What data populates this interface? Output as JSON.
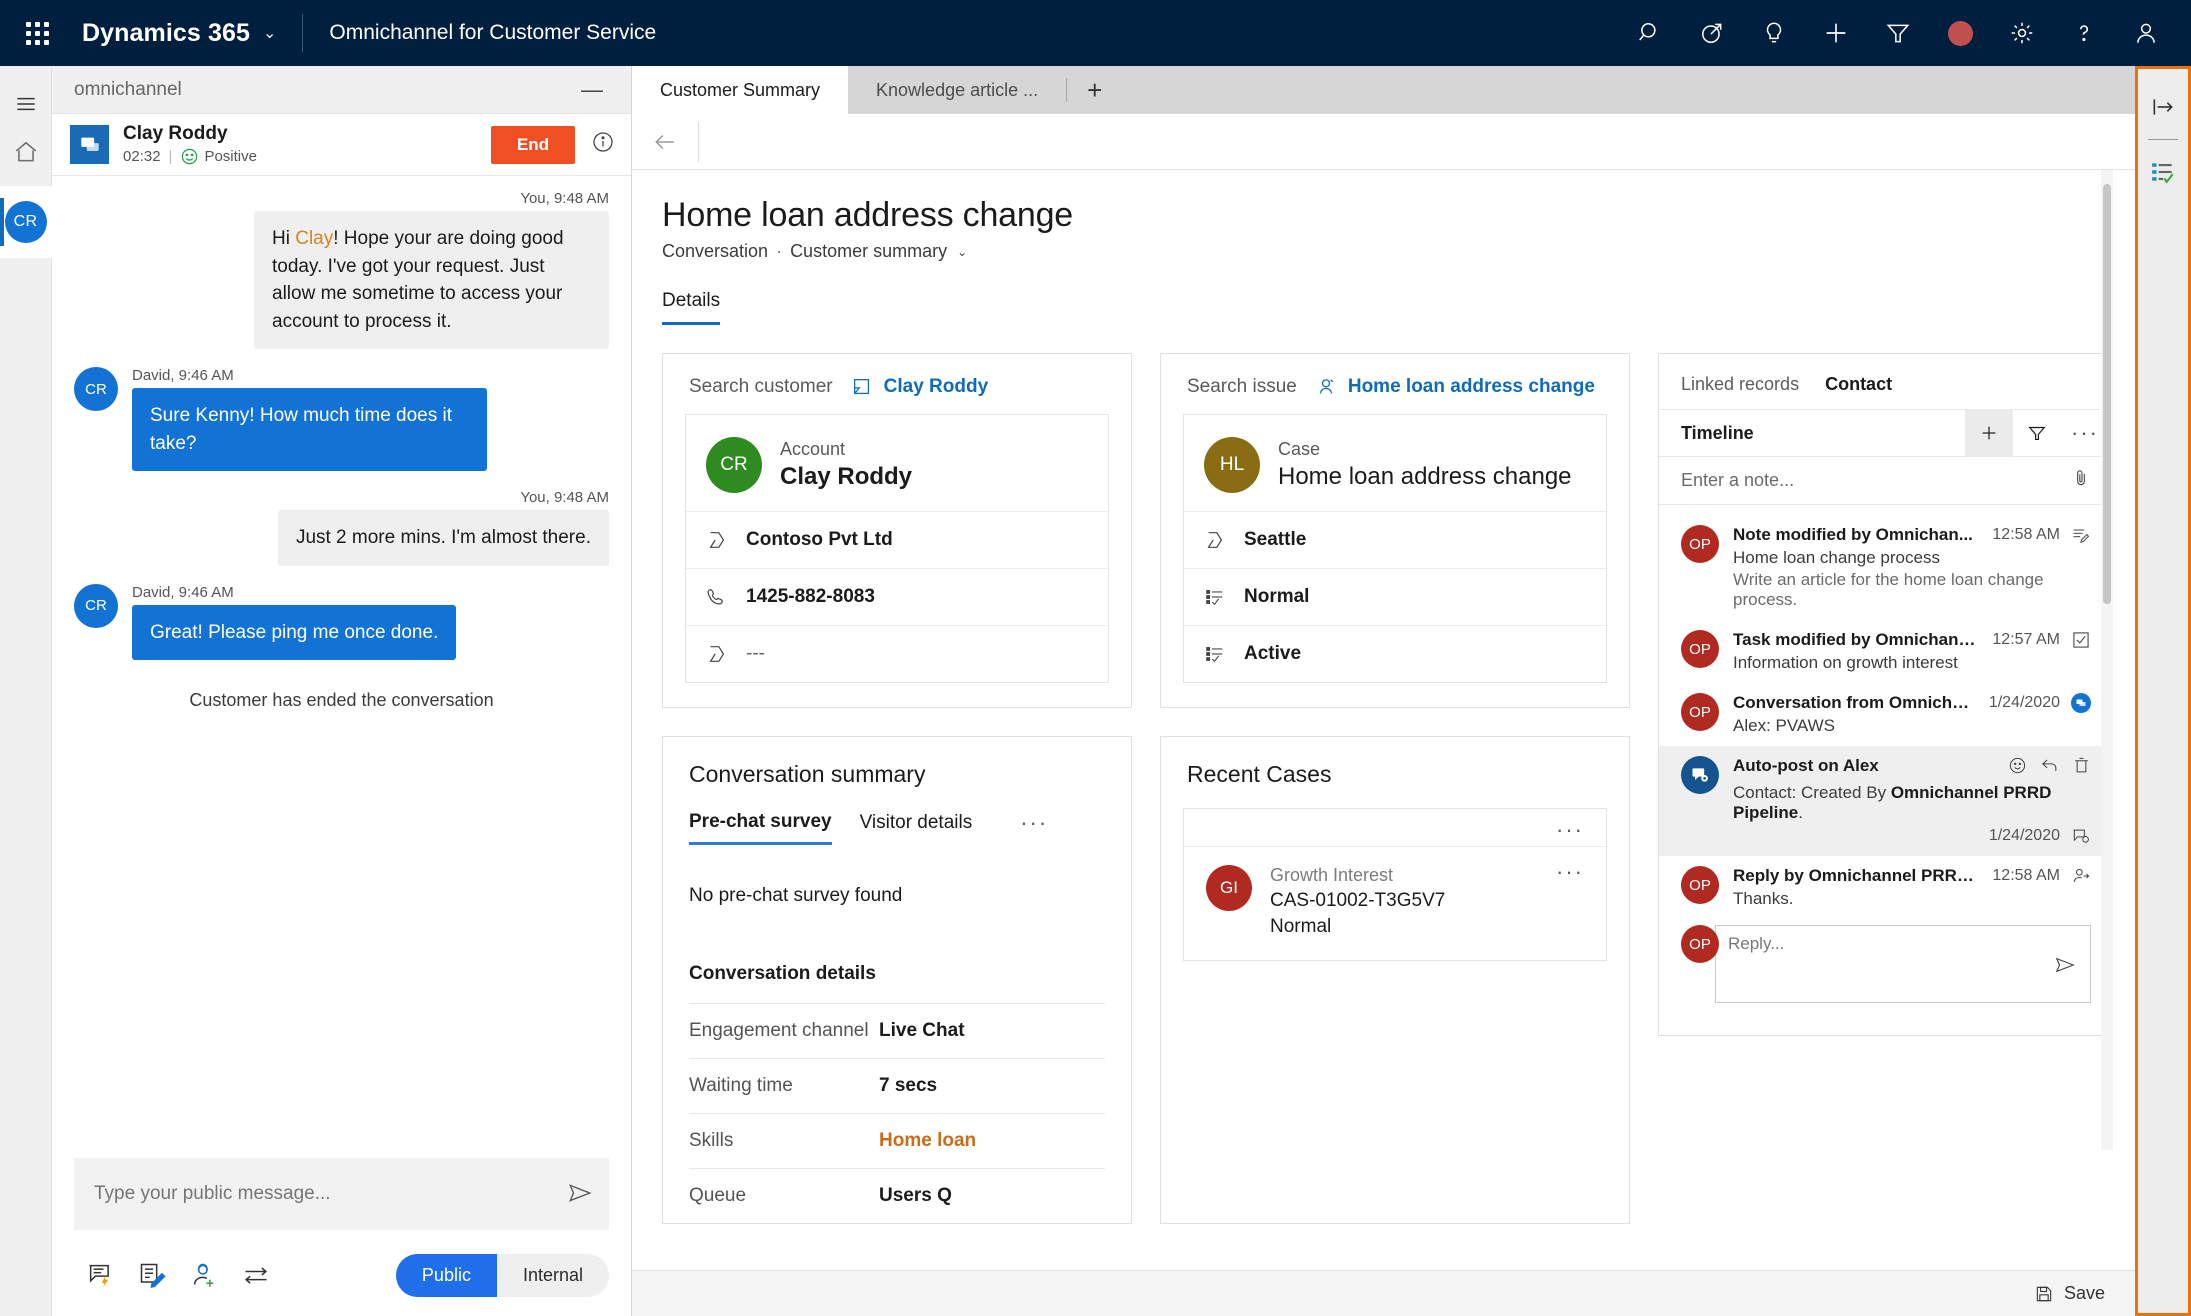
{
  "topnav": {
    "waffle_label": "app-launcher",
    "brand": "Dynamics 365",
    "app_name": "Omnichannel for Customer Service",
    "icons": [
      "search-icon",
      "assign-icon",
      "lightbulb-icon",
      "plus-icon",
      "filter-icon",
      "record-indicator",
      "gear-icon",
      "help-icon",
      "user-icon"
    ]
  },
  "rail": {
    "menu": "hamburger-icon",
    "home": "home-icon",
    "avatar_initials": "CR"
  },
  "chat": {
    "panel_label": "omnichannel",
    "minimize": "—",
    "customer_name": "Clay Roddy",
    "duration": "02:32",
    "sentiment": "Positive",
    "end_button": "End",
    "messages": [
      {
        "direction": "out",
        "timestamp": "You, 9:48 AM",
        "text_pre": "Hi ",
        "highlight": "Clay",
        "text_post": "! Hope your are doing good today. I've got your request. Just allow me sometime to access your account to process it."
      },
      {
        "direction": "in",
        "author": "David, 9:46 AM",
        "avatar": "CR",
        "text": "Sure Kenny! How much time does it take?"
      },
      {
        "direction": "out",
        "timestamp": "You, 9:48 AM",
        "text_post": "Just 2 more mins. I'm almost there."
      },
      {
        "direction": "in",
        "author": "David, 9:46 AM",
        "avatar": "CR",
        "text": "Great! Please ping me once done."
      }
    ],
    "ended_notice": "Customer has ended the conversation",
    "compose_placeholder": "Type your public message...",
    "footer_icons": [
      "quick-reply-icon",
      "notes-icon",
      "consult-icon",
      "transfer-icon"
    ],
    "toggle": {
      "public": "Public",
      "internal": "Internal",
      "selected": "Public"
    }
  },
  "main": {
    "tabs": [
      {
        "label": "Customer Summary",
        "active": true
      },
      {
        "label": "Knowledge article ...",
        "active": false
      }
    ],
    "add_tab": "+",
    "page_title": "Home loan address change",
    "breadcrumb": {
      "parent": "Conversation",
      "current": "Customer summary"
    },
    "detail_tab": "Details"
  },
  "customer_card": {
    "search_label": "Search customer",
    "search_value": "Clay Roddy",
    "entity_type": "Account",
    "entity_name": "Clay Roddy",
    "avatar_initials": "CR",
    "avatar_color": "#2e8b20",
    "fields": [
      {
        "icon": "company-icon",
        "value": "Contoso Pvt Ltd",
        "muted": false
      },
      {
        "icon": "phone-icon",
        "value": "1425-882-8083",
        "muted": false
      },
      {
        "icon": "company-icon",
        "value": "---",
        "muted": true
      }
    ]
  },
  "issue_card": {
    "search_label": "Search issue",
    "search_value": "Home loan address change",
    "entity_type": "Case",
    "entity_name": "Home loan address change",
    "avatar_initials": "HL",
    "avatar_color": "#8a6d12",
    "fields": [
      {
        "icon": "location-icon",
        "value": "Seattle",
        "muted": false
      },
      {
        "icon": "priority-icon",
        "value": "Normal",
        "muted": false
      },
      {
        "icon": "status-icon",
        "value": "Active",
        "muted": false
      }
    ]
  },
  "conversation_card": {
    "title": "Conversation summary",
    "tabs": [
      {
        "label": "Pre-chat survey",
        "active": true
      },
      {
        "label": "Visitor details",
        "active": false
      }
    ],
    "more": "···",
    "empty_text": "No pre-chat survey found",
    "details_heading": "Conversation details",
    "details": [
      {
        "key": "Engagement channel",
        "value": "Live Chat",
        "accent": false
      },
      {
        "key": "Waiting time",
        "value": "7 secs",
        "accent": false
      },
      {
        "key": "Skills",
        "value": "Home loan",
        "accent": true
      },
      {
        "key": "Queue",
        "value": "Users Q",
        "accent": false
      }
    ]
  },
  "recent_cases": {
    "title": "Recent Cases",
    "items": [
      {
        "avatar_initials": "GI",
        "title": "Growth Interest",
        "case_number": "CAS-01002-T3G5V7",
        "priority": "Normal",
        "more": "···"
      }
    ],
    "header_more": "···"
  },
  "timeline": {
    "tabs": [
      {
        "label": "Linked records",
        "active": false
      },
      {
        "label": "Contact",
        "active": true
      }
    ],
    "header": "Timeline",
    "actions": [
      "plus-icon",
      "filter-icon",
      "more-icon"
    ],
    "note_placeholder": "Enter a note...",
    "attach_icon": "paperclip-icon",
    "items": [
      {
        "avatar": "OP",
        "avatar_style": "red",
        "title": "Note modified by Omnichan...",
        "time": "12:58 AM",
        "icon": "note-icon",
        "sub1": "Home loan change process",
        "sub2": "Write an article for the home loan change process.",
        "selected": false
      },
      {
        "avatar": "OP",
        "avatar_style": "red",
        "title": "Task modified by Omnichann...",
        "time": "12:57 AM",
        "icon": "task-checkbox-icon",
        "sub1": "Information on growth interest",
        "selected": false
      },
      {
        "avatar": "OP",
        "avatar_style": "red",
        "title": "Conversation from Omnichan...",
        "time": "1/24/2020",
        "icon": "conversation-badge-icon",
        "sub1": "Alex: PVAWS",
        "selected": false
      },
      {
        "avatar": "",
        "avatar_style": "blue-post",
        "title": "Auto-post on Alex",
        "time": "1/24/2020",
        "icon": "post-icon",
        "sub1_pre": "Contact: Created By ",
        "sub1_bold": "Omnichannel PRRD Pipeline",
        "sub1_post": ".",
        "row_actions": [
          "emoji-icon",
          "reply-icon",
          "delete-icon"
        ],
        "selected": true
      },
      {
        "avatar": "OP",
        "avatar_style": "red",
        "title": "Reply by Omnichannel PRRD Pipeline",
        "time": "12:58 AM",
        "icon": "reply-post-icon",
        "sub1": "Thanks.",
        "selected": false
      }
    ],
    "reply": {
      "avatar": "OP",
      "placeholder": "Reply...",
      "send_icon": "send-icon"
    }
  },
  "edge_panel": {
    "expand": "expand-panel-icon",
    "agent_script": "agent-script-icon"
  },
  "statusbar": {
    "save_label": "Save",
    "save_icon": "save-icon"
  }
}
